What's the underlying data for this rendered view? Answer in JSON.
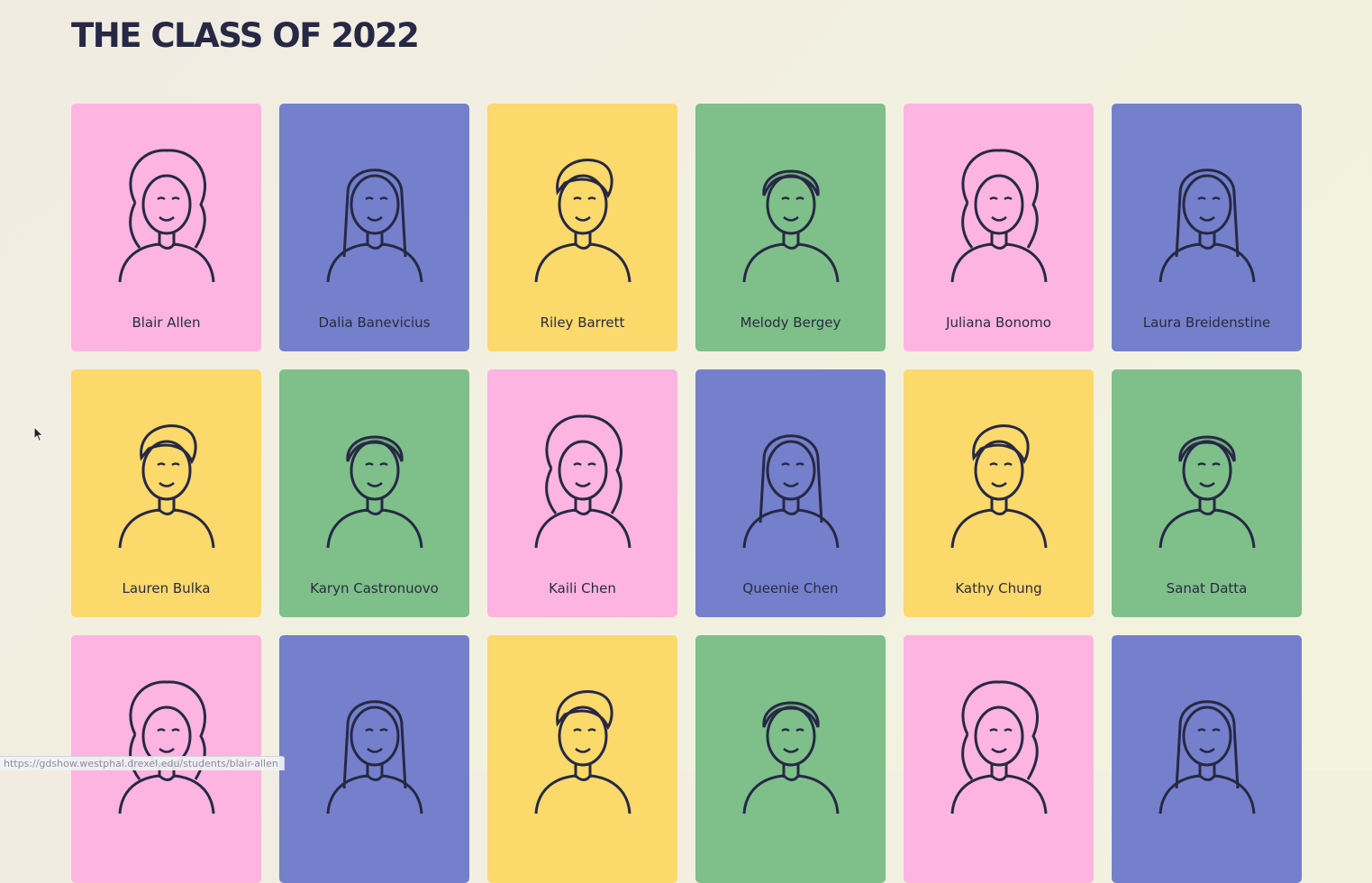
{
  "page": {
    "title": "THE CLASS OF 2022"
  },
  "colors": {
    "pink": "#fdb4e1",
    "blue": "#7480cb",
    "yellow": "#fbd96b",
    "green": "#7ebf8a",
    "ink": "#262844"
  },
  "students": [
    {
      "name": "Blair Allen",
      "color": "pink"
    },
    {
      "name": "Dalia Banevicius",
      "color": "blue"
    },
    {
      "name": "Riley Barrett",
      "color": "yellow"
    },
    {
      "name": "Melody Bergey",
      "color": "green"
    },
    {
      "name": "Juliana Bonomo",
      "color": "pink"
    },
    {
      "name": "Laura Breidenstine",
      "color": "blue"
    },
    {
      "name": "Lauren Bulka",
      "color": "yellow"
    },
    {
      "name": "Karyn Castronuovo",
      "color": "green"
    },
    {
      "name": "Kaili Chen",
      "color": "pink"
    },
    {
      "name": "Queenie Chen",
      "color": "blue"
    },
    {
      "name": "Kathy Chung",
      "color": "yellow"
    },
    {
      "name": "Sanat Datta",
      "color": "green"
    },
    {
      "name": "",
      "color": "pink"
    },
    {
      "name": "",
      "color": "blue"
    },
    {
      "name": "",
      "color": "yellow"
    },
    {
      "name": "",
      "color": "green"
    },
    {
      "name": "",
      "color": "pink"
    },
    {
      "name": "",
      "color": "blue"
    }
  ],
  "status_bar": {
    "url": "https://gdshow.westphal.drexel.edu/students/blair-allen"
  }
}
